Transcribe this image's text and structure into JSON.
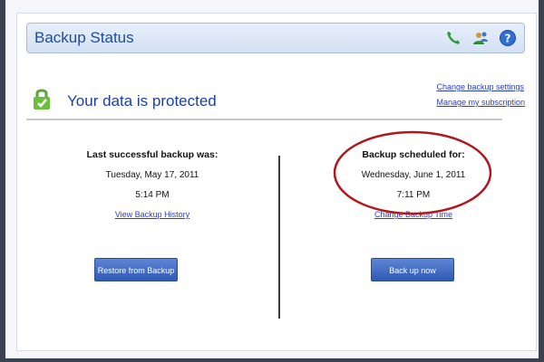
{
  "header": {
    "title": "Backup Status",
    "icons": [
      "phone-icon",
      "users-icon",
      "help-icon"
    ]
  },
  "status": {
    "text": "Your data is protected",
    "icon": "lock-icon"
  },
  "links": {
    "change_settings": "Change backup settings",
    "manage_subscription": "Manage my subscription"
  },
  "last_backup": {
    "heading": "Last successful backup was:",
    "date": "Tuesday, May 17, 2011",
    "time": "5:14 PM",
    "history_link": "View Backup History",
    "button": "Restore from Backup"
  },
  "scheduled_backup": {
    "heading": "Backup scheduled for:",
    "date": "Wednesday, June 1, 2011",
    "time": "7:11 PM",
    "change_link": "Change Backup Time",
    "button": "Back up now"
  },
  "colors": {
    "title_blue": "#1d4d9a",
    "status_blue": "#1b3fa8",
    "link_blue": "#2a3fc4",
    "button_blue": "#2e59b5",
    "highlight_red": "#b0181e"
  }
}
